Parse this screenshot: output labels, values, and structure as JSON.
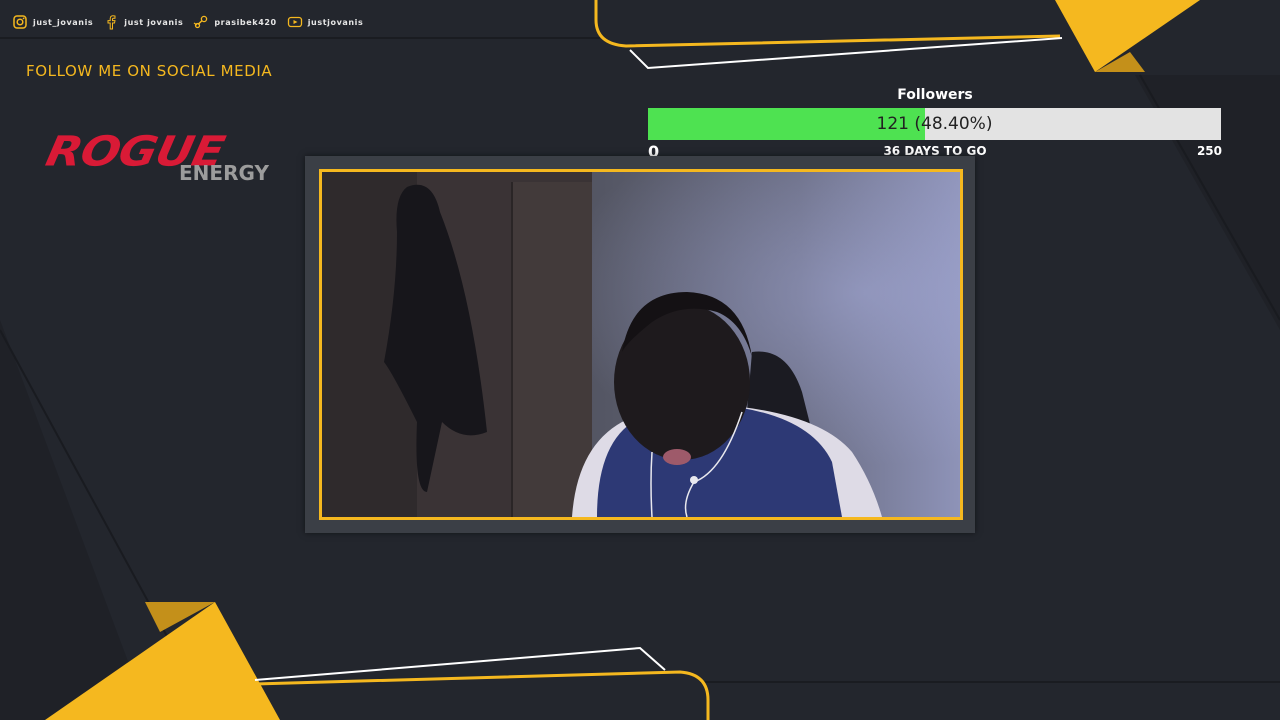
{
  "social": [
    {
      "icon": "instagram-icon",
      "label": "just_jovanis"
    },
    {
      "icon": "facebook-icon",
      "label": "just jovanis"
    },
    {
      "icon": "steam-icon",
      "label": "prasibek420"
    },
    {
      "icon": "youtube-icon",
      "label": "justjovanis"
    }
  ],
  "follow_text": "FOLLOW ME ON SOCIAL MEDIA",
  "logo": {
    "main": "ROGUE",
    "sub": "ENERGY"
  },
  "goal": {
    "title": "Followers",
    "current": 121,
    "target": 250,
    "progress_fraction": 0.484,
    "value_text": "121 (48.40%)",
    "min_label": "0",
    "max_label": "250",
    "days_left_text": "36 DAYS TO GO"
  },
  "colors": {
    "background": "#23262d",
    "accent": "#f5b81f",
    "progress_fill": "#4ee251",
    "progress_track": "#e3e3e3",
    "logo_red": "#d91a36"
  }
}
